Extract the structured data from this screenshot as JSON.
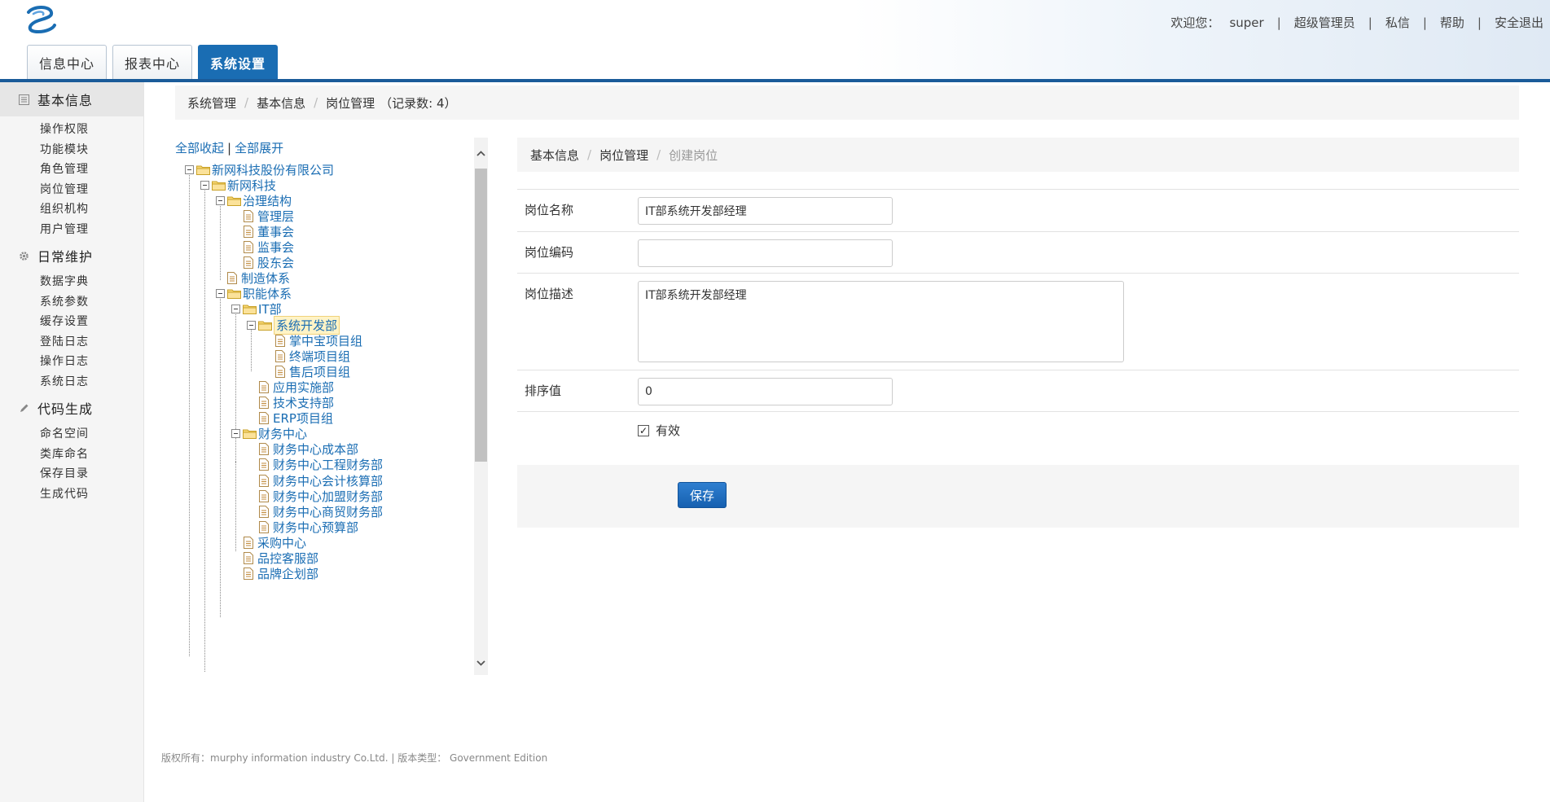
{
  "header": {
    "welcome": "欢迎您：",
    "username": "super",
    "role": "超级管理员",
    "links": [
      "私信",
      "帮助",
      "安全退出"
    ],
    "tabs": [
      "信息中心",
      "报表中心",
      "系统设置"
    ],
    "active_tab": "系统设置"
  },
  "sidebar": {
    "groups": [
      {
        "title": "基本信息",
        "icon": "list-icon",
        "items": [
          "操作权限",
          "功能模块",
          "角色管理",
          "岗位管理",
          "组织机构",
          "用户管理"
        ]
      },
      {
        "title": "日常维护",
        "icon": "gear-icon",
        "items": [
          "数据字典",
          "系统参数",
          "缓存设置",
          "登陆日志",
          "操作日志",
          "系统日志"
        ]
      },
      {
        "title": "代码生成",
        "icon": "pencil-icon",
        "items": [
          "命名空间",
          "类库命名",
          "保存目录",
          "生成代码"
        ]
      }
    ]
  },
  "breadcrumb": {
    "items": [
      "系统管理",
      "基本信息",
      "岗位管理"
    ],
    "count_text": "（记录数: 4）"
  },
  "tree": {
    "collapse_all": "全部收起",
    "expand_all": "全部展开",
    "nodes": [
      {
        "label": "新网科技股份有限公司",
        "type": "folder"
      },
      {
        "label": "新网科技",
        "type": "folder"
      },
      {
        "label": "治理结构",
        "type": "folder"
      },
      {
        "label": "管理层",
        "type": "doc"
      },
      {
        "label": "董事会",
        "type": "doc"
      },
      {
        "label": "监事会",
        "type": "doc"
      },
      {
        "label": "股东会",
        "type": "doc"
      },
      {
        "label": "制造体系",
        "type": "doc"
      },
      {
        "label": "职能体系",
        "type": "folder"
      },
      {
        "label": "IT部",
        "type": "folder"
      },
      {
        "label": "系统开发部",
        "type": "folder",
        "selected": true
      },
      {
        "label": "掌中宝项目组",
        "type": "doc"
      },
      {
        "label": "终端项目组",
        "type": "doc"
      },
      {
        "label": "售后项目组",
        "type": "doc"
      },
      {
        "label": "应用实施部",
        "type": "doc"
      },
      {
        "label": "技术支持部",
        "type": "doc"
      },
      {
        "label": "ERP项目组",
        "type": "doc"
      },
      {
        "label": "财务中心",
        "type": "folder"
      },
      {
        "label": "财务中心成本部",
        "type": "doc"
      },
      {
        "label": "财务中心工程财务部",
        "type": "doc"
      },
      {
        "label": "财务中心会计核算部",
        "type": "doc"
      },
      {
        "label": "财务中心加盟财务部",
        "type": "doc"
      },
      {
        "label": "财务中心商贸财务部",
        "type": "doc"
      },
      {
        "label": "财务中心预算部",
        "type": "doc"
      },
      {
        "label": "采购中心",
        "type": "doc"
      },
      {
        "label": "品控客服部",
        "type": "doc"
      },
      {
        "label": "品牌企划部",
        "type": "doc"
      }
    ]
  },
  "form": {
    "breadcrumb": [
      "基本信息",
      "岗位管理",
      "创建岗位"
    ],
    "fields": {
      "name_label": "岗位名称",
      "name_value": "IT部系统开发部经理",
      "code_label": "岗位编码",
      "code_value": "",
      "desc_label": "岗位描述",
      "desc_value": "IT部系统开发部经理",
      "order_label": "排序值",
      "order_value": "0",
      "valid_label": "有效",
      "valid_checked": true
    },
    "save_label": "保存"
  },
  "footer": {
    "text": "版权所有：murphy information industry Co.Ltd. | 版本类型： Government Edition"
  },
  "colors": {
    "brand_blue": "#1a6db3",
    "header_line": "#1a5b99"
  }
}
